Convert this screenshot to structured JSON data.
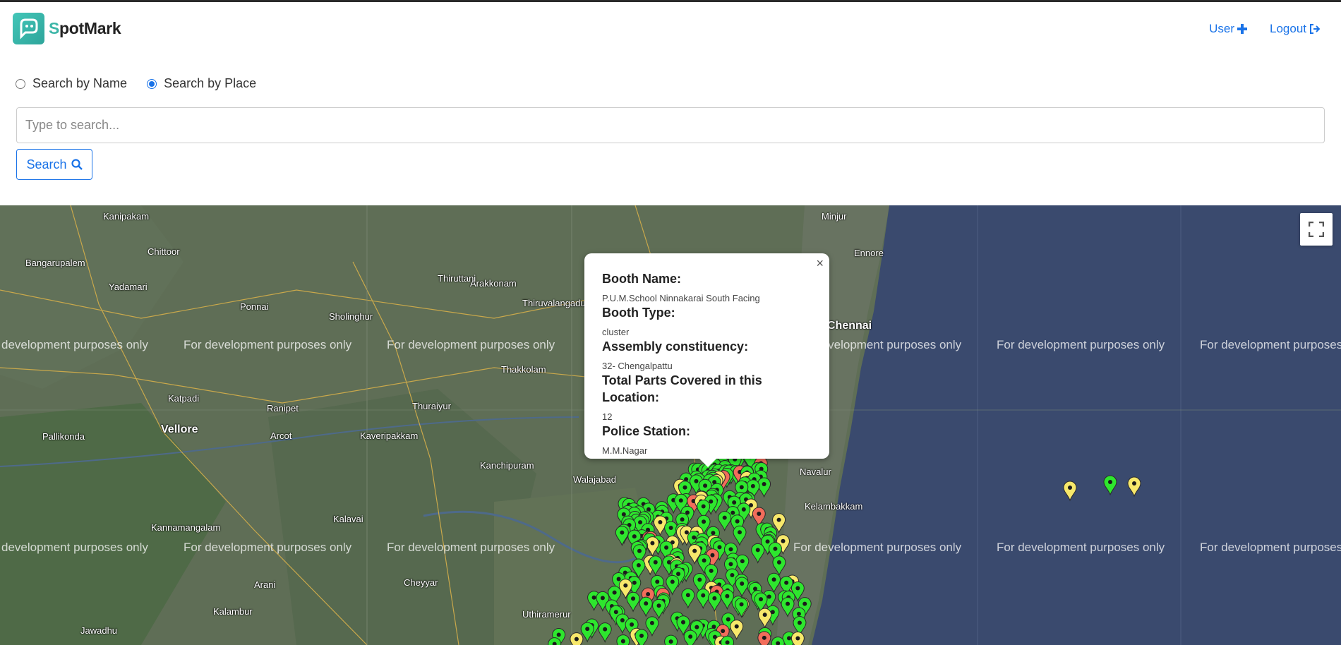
{
  "header": {
    "app_name_first": "S",
    "app_name_rest": "potMark",
    "nav": [
      {
        "label": "User",
        "icon": "user-plus-icon"
      },
      {
        "label": "Logout",
        "icon": "sign-out-icon"
      }
    ]
  },
  "search": {
    "mode_options": [
      {
        "label": "Search by Name",
        "selected": false
      },
      {
        "label": "Search by Place",
        "selected": true
      }
    ],
    "placeholder": "Type to search...",
    "button_label": "Search",
    "button_icon": "search-icon"
  },
  "map": {
    "watermark": "For development purposes only",
    "watermark_left": "development purposes only",
    "watermark_right": "For development purposes",
    "places": [
      "Kanipakam",
      "Chittoor",
      "Bangarupalem",
      "Yadamari",
      "Ponnai",
      "Sholinghur",
      "Arakkonam",
      "Thiruttani",
      "Vellore",
      "Katpadi",
      "Ranipet",
      "Arcot",
      "Kaveripakkam",
      "Pallikonda",
      "Kanchipuram",
      "Walajabad",
      "Thakkolam",
      "Thuraiyur",
      "Kalavai",
      "Kannamangalam",
      "Cheyyar",
      "Arani",
      "Kalambur",
      "Jawadhu",
      "Uthiramerur",
      "Chennai",
      "Ennore",
      "Minjur",
      "Navalur",
      "Kelambakkam",
      "Thiruvalangadu"
    ],
    "colors": {
      "green": "#2ee62e",
      "yellow": "#f7e86b",
      "red": "#f26d5b",
      "sea": "#3a4a6e"
    }
  },
  "popup": {
    "fields": [
      {
        "label": "Booth Name:",
        "value": "P.U.M.School Ninnakarai South Facing"
      },
      {
        "label": "Booth Type:",
        "value": "cluster"
      },
      {
        "label": "Assembly constituency:",
        "value": "32- Chengalpattu"
      },
      {
        "label": "Total Parts Covered in this Location:",
        "value": "12"
      },
      {
        "label": "Police Station:",
        "value": "M.M.Nagar"
      }
    ],
    "close": "×"
  }
}
